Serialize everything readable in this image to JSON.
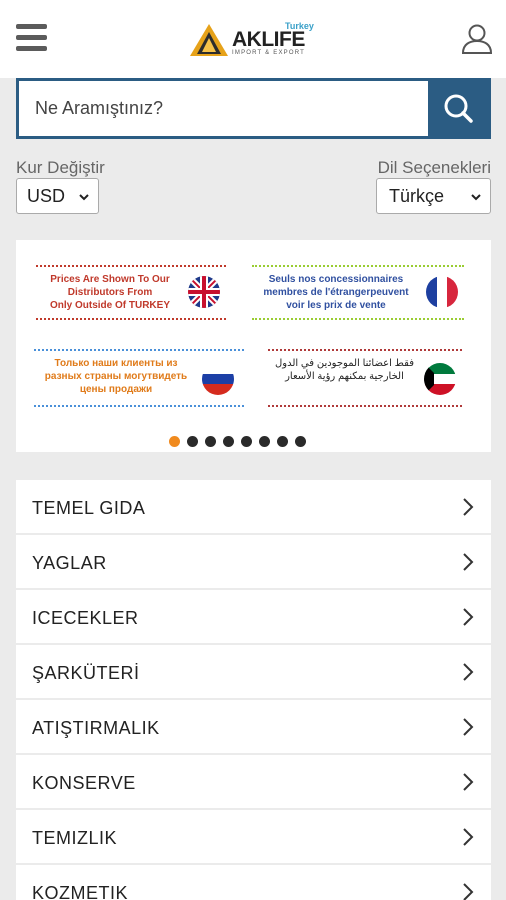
{
  "header": {
    "logo_text": "AKLIFE",
    "logo_sub": "IMPORT & EXPORT",
    "logo_country": "Turkey",
    "menu_icon": "hamburger-icon",
    "user_icon": "user-icon"
  },
  "search": {
    "placeholder": "Ne Aramıştınız?",
    "value": "",
    "button_icon": "search-icon"
  },
  "currency": {
    "label": "Kur Değiştir",
    "selected": "USD"
  },
  "language": {
    "label": "Dil Seçenekleri",
    "selected": "Türkçe"
  },
  "banner": {
    "slides": [
      {
        "lines": [
          "Prices Are Shown To Our",
          "Distributors From",
          "Only Outside Of TURKEY"
        ],
        "flag": "uk-flag"
      },
      {
        "lines": [
          "Seuls nos concessionnaires",
          "membres de l'étrangerpeuvent",
          "voir les prix de vente"
        ],
        "flag": "france-flag"
      },
      {
        "lines": [
          "Только наши клиенты из",
          "разных страны могутвидеть",
          "цены продажи"
        ],
        "flag": "russia-flag"
      },
      {
        "lines": [
          "فقط اعضائنا الموجودين في الدول",
          "الخارجية بمكنهم رؤية الأسعار"
        ],
        "flag": "kuwait-flag"
      }
    ],
    "dots_total": 8,
    "active_dot": 1
  },
  "categories": [
    {
      "label": "TEMEL GIDA"
    },
    {
      "label": "YAGLAR"
    },
    {
      "label": "ICECEKLER"
    },
    {
      "label": "ŞARKÜTERİ"
    },
    {
      "label": "ATIŞTIRMALIK"
    },
    {
      "label": "KONSERVE"
    },
    {
      "label": "TEMIZLIK"
    },
    {
      "label": "KOZMETIK"
    }
  ],
  "colors": {
    "accent": "#2b5c83",
    "dot_active": "#f08a1e"
  }
}
